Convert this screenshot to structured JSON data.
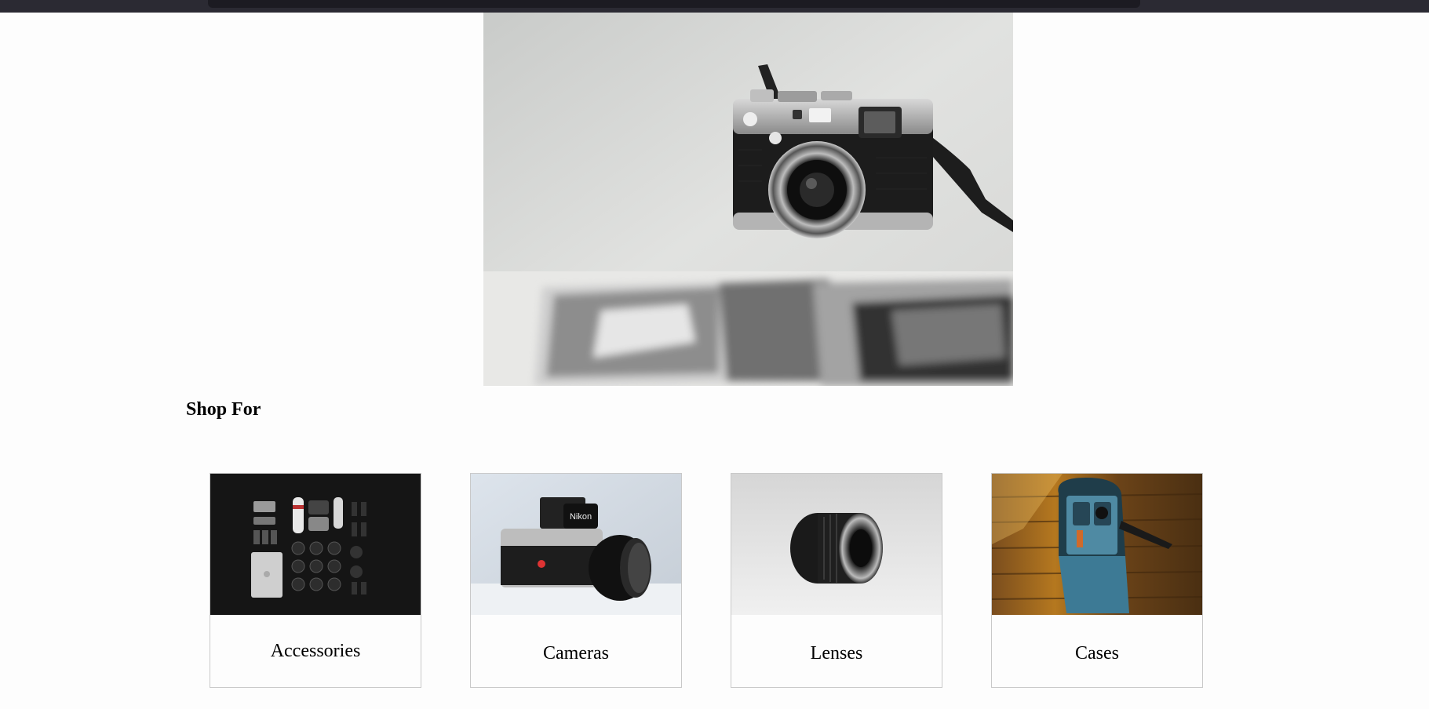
{
  "hero": {
    "image_name": "camera-hero-photo"
  },
  "section": {
    "title": "Shop For"
  },
  "categories": [
    {
      "label": "Accessories",
      "icon": "accessories-photo"
    },
    {
      "label": "Cameras",
      "icon": "nikon-camera-photo"
    },
    {
      "label": "Lenses",
      "icon": "lens-photo"
    },
    {
      "label": "Cases",
      "icon": "backpack-case-photo"
    }
  ],
  "colors": {
    "topbar": "#2b2a33",
    "page_bg": "#fdfdfd",
    "card_border": "#c9c9c9"
  }
}
